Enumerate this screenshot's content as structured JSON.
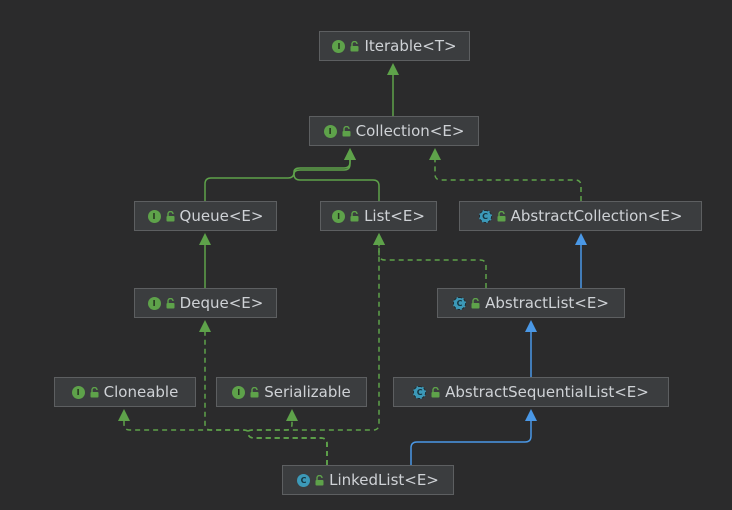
{
  "colors": {
    "background": "#2b2b2c",
    "node_fill": "#3b3d3f",
    "node_border": "#5d5f61",
    "text": "#cfd2d6",
    "interface_edge": "#5ea24a",
    "class_edge": "#4a98e6",
    "interface_badge": "#5ea24a",
    "class_badge": "#3c99b8"
  },
  "nodes": [
    {
      "id": "iterable",
      "label": "Iterable<T>",
      "kind": "interface",
      "badge_letter": "I",
      "icon": "interface-icon"
    },
    {
      "id": "collection",
      "label": "Collection<E>",
      "kind": "interface",
      "badge_letter": "I",
      "icon": "interface-icon"
    },
    {
      "id": "queue",
      "label": "Queue<E>",
      "kind": "interface",
      "badge_letter": "I",
      "icon": "interface-icon"
    },
    {
      "id": "list",
      "label": "List<E>",
      "kind": "interface",
      "badge_letter": "I",
      "icon": "interface-icon"
    },
    {
      "id": "abstractcollection",
      "label": "AbstractCollection<E>",
      "kind": "abstract",
      "badge_letter": "C",
      "icon": "abstract-class-icon"
    },
    {
      "id": "deque",
      "label": "Deque<E>",
      "kind": "interface",
      "badge_letter": "I",
      "icon": "interface-icon"
    },
    {
      "id": "abstractlist",
      "label": "AbstractList<E>",
      "kind": "abstract",
      "badge_letter": "C",
      "icon": "abstract-class-icon"
    },
    {
      "id": "cloneable",
      "label": "Cloneable",
      "kind": "interface",
      "badge_letter": "I",
      "icon": "interface-icon"
    },
    {
      "id": "serializable",
      "label": "Serializable",
      "kind": "interface",
      "badge_letter": "I",
      "icon": "interface-icon"
    },
    {
      "id": "abstractsequentiallist",
      "label": "AbstractSequentialList<E>",
      "kind": "abstract",
      "badge_letter": "C",
      "icon": "abstract-class-icon"
    },
    {
      "id": "linkedlist",
      "label": "LinkedList<E>",
      "kind": "class",
      "badge_letter": "C",
      "icon": "class-icon"
    }
  ],
  "edges": [
    {
      "from": "collection",
      "to": "iterable",
      "type": "extends"
    },
    {
      "from": "queue",
      "to": "collection",
      "type": "extends"
    },
    {
      "from": "list",
      "to": "collection",
      "type": "extends"
    },
    {
      "from": "abstractcollection",
      "to": "collection",
      "type": "implements"
    },
    {
      "from": "deque",
      "to": "queue",
      "type": "extends"
    },
    {
      "from": "abstractlist",
      "to": "abstractcollection",
      "type": "class-extends"
    },
    {
      "from": "abstractlist",
      "to": "list",
      "type": "implements"
    },
    {
      "from": "abstractsequentiallist",
      "to": "abstractlist",
      "type": "class-extends"
    },
    {
      "from": "linkedlist",
      "to": "abstractsequentiallist",
      "type": "class-extends"
    },
    {
      "from": "linkedlist",
      "to": "cloneable",
      "type": "implements"
    },
    {
      "from": "linkedlist",
      "to": "serializable",
      "type": "implements"
    },
    {
      "from": "linkedlist",
      "to": "deque",
      "type": "implements"
    },
    {
      "from": "linkedlist",
      "to": "list",
      "type": "implements"
    }
  ]
}
